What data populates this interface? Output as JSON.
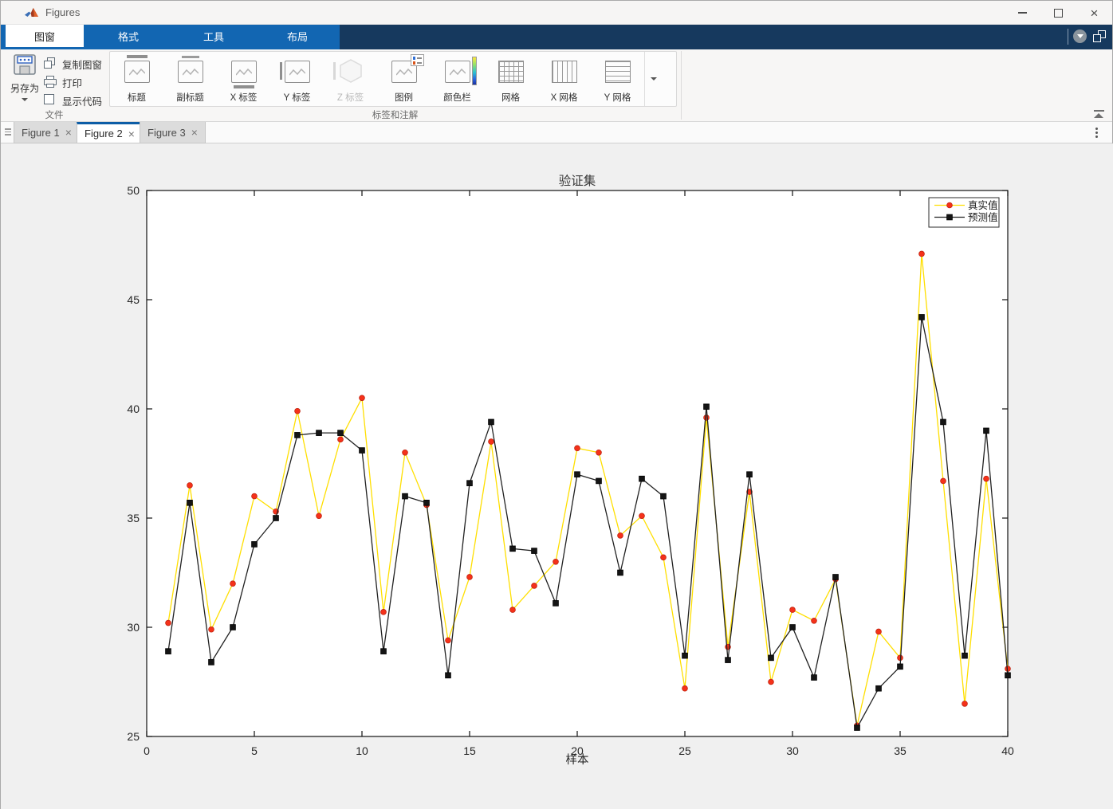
{
  "window": {
    "title": "Figures"
  },
  "glyphs": {
    "close_tab": "×",
    "dropdown": "▾"
  },
  "toolstrip": {
    "tabs": [
      {
        "label": "图窗",
        "active": true
      },
      {
        "label": "格式",
        "active": false
      },
      {
        "label": "工具",
        "active": false
      },
      {
        "label": "布局",
        "active": false
      }
    ],
    "file_group": {
      "label": "文件",
      "save": "另存为",
      "copy": "复制图窗",
      "print": "打印",
      "show_code": "显示代码"
    },
    "annotation_group": {
      "label": "标签和注解",
      "items": [
        {
          "label": "标题",
          "disabled": false
        },
        {
          "label": "副标题",
          "disabled": false
        },
        {
          "label": "X 标签",
          "disabled": false
        },
        {
          "label": "Y 标签",
          "disabled": false
        },
        {
          "label": "Z 标签",
          "disabled": true
        },
        {
          "label": "图例",
          "disabled": false
        },
        {
          "label": "颜色栏",
          "disabled": false
        },
        {
          "label": "网格",
          "disabled": false
        },
        {
          "label": "X 网格",
          "disabled": false
        },
        {
          "label": "Y 网格",
          "disabled": false
        }
      ]
    }
  },
  "figure_tabs": [
    {
      "label": "Figure 1",
      "active": false
    },
    {
      "label": "Figure 2",
      "active": true
    },
    {
      "label": "Figure 3",
      "active": false
    }
  ],
  "colors": {
    "toolstrip_blue": "#1266b2",
    "toolstrip_navy": "#16395e",
    "active_figtab_accent": "#0d5da6",
    "figure_background": "#f0f0f0",
    "axes_background": "#ffffff",
    "real_line": "#ffdf00",
    "real_marker": "#f5311a",
    "pred_line": "#212121",
    "pred_marker": "#141414"
  },
  "chart_data": {
    "type": "line",
    "title": "验证集",
    "xlabel": "样本",
    "ylabel": "",
    "xlim": [
      0,
      40
    ],
    "ylim": [
      25,
      50
    ],
    "xticks": [
      0,
      5,
      10,
      15,
      20,
      25,
      30,
      35,
      40
    ],
    "yticks": [
      25,
      30,
      35,
      40,
      45,
      50
    ],
    "grid": false,
    "legend": {
      "position": "top-right",
      "entries": [
        "真实值",
        "预测值"
      ]
    },
    "x": [
      1,
      2,
      3,
      4,
      5,
      6,
      7,
      8,
      9,
      10,
      11,
      12,
      13,
      14,
      15,
      16,
      17,
      18,
      19,
      20,
      21,
      22,
      23,
      24,
      25,
      26,
      27,
      28,
      29,
      30,
      31,
      32,
      33,
      34,
      35,
      36,
      37,
      38,
      39,
      40
    ],
    "series": [
      {
        "name": "真实值",
        "line_color": "#ffdf00",
        "marker": "circle",
        "marker_color": "#f5311a",
        "values": [
          30.2,
          36.5,
          29.9,
          32.0,
          36.0,
          35.3,
          39.9,
          35.1,
          38.6,
          40.5,
          30.7,
          38.0,
          35.6,
          29.4,
          32.3,
          38.5,
          30.8,
          31.9,
          33.0,
          38.2,
          38.0,
          34.2,
          35.1,
          33.2,
          27.2,
          39.6,
          29.1,
          36.2,
          27.5,
          30.8,
          30.3,
          32.2,
          25.5,
          29.8,
          28.6,
          47.1,
          36.7,
          26.5,
          36.8,
          28.1
        ]
      },
      {
        "name": "预测值",
        "line_color": "#212121",
        "marker": "square",
        "marker_color": "#141414",
        "values": [
          28.9,
          35.7,
          28.4,
          30.0,
          33.8,
          35.0,
          38.8,
          38.9,
          38.9,
          38.1,
          28.9,
          36.0,
          35.7,
          27.8,
          36.6,
          39.4,
          33.6,
          33.5,
          31.1,
          37.0,
          36.7,
          32.5,
          36.8,
          36.0,
          28.7,
          40.1,
          28.5,
          37.0,
          28.6,
          30.0,
          27.7,
          32.3,
          25.4,
          27.2,
          28.2,
          44.2,
          39.4,
          28.7,
          39.0,
          27.8
        ]
      }
    ]
  }
}
